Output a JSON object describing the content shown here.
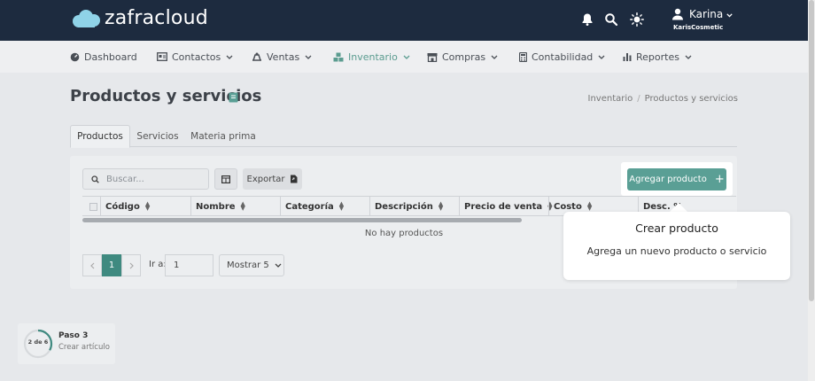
{
  "app": {
    "logo_text": "zafracloud"
  },
  "user": {
    "name": "Karina",
    "company": "KarisCosmetic"
  },
  "nav": {
    "items": [
      {
        "label": "Dashboard",
        "icon": "dashboard-icon"
      },
      {
        "label": "Contactos",
        "icon": "contacts-icon"
      },
      {
        "label": "Ventas",
        "icon": "sales-icon"
      },
      {
        "label": "Inventario",
        "icon": "inventory-icon",
        "active": true
      },
      {
        "label": "Compras",
        "icon": "store-icon"
      },
      {
        "label": "Contabilidad",
        "icon": "calculator-icon"
      },
      {
        "label": "Reportes",
        "icon": "chart-icon"
      }
    ]
  },
  "page": {
    "title": "Productos y servicios"
  },
  "breadcrumb": {
    "parent": "Inventario",
    "separator": "/",
    "current": "Productos y servicios"
  },
  "tabs": [
    "Productos",
    "Servicios",
    "Materia prima"
  ],
  "toolbar": {
    "search_placeholder": "Buscar...",
    "export_label": "Exportar",
    "add_label": "Agregar producto",
    "add_icon": "+"
  },
  "table": {
    "columns": [
      "Código",
      "Nombre",
      "Categoría",
      "Descripción",
      "Precio de venta",
      "Costo",
      "Desc. %"
    ],
    "empty_message": "No hay productos"
  },
  "pagination": {
    "current_page": "1",
    "goto_label": "Ir a:",
    "goto_value": "1",
    "page_size_label": "Mostrar 5"
  },
  "tooltip": {
    "title": "Crear producto",
    "body": "Agrega un nuevo producto o servicio"
  },
  "tour": {
    "count": "2 de 6",
    "title": "Paso 3",
    "subtitle": "Crear artículo",
    "progress": 0.33
  },
  "colors": {
    "topbar": "#1d2b3f",
    "accent": "#5a9f95",
    "active_page": "#3f8a80"
  }
}
